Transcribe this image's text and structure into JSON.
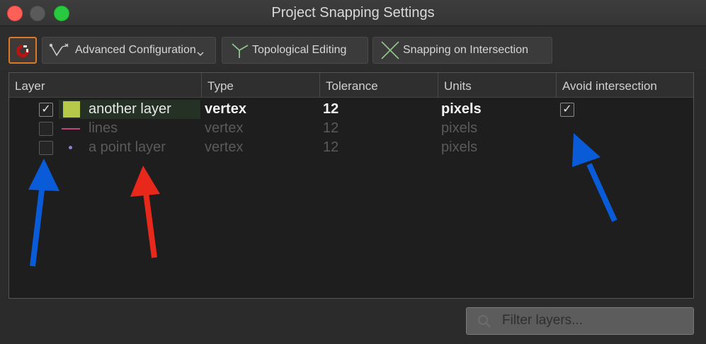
{
  "window": {
    "title": "Project Snapping Settings"
  },
  "toolbar": {
    "magnet_icon": "magnet-icon",
    "advanced_label": "Advanced Configuration",
    "topological_label": "Topological Editing",
    "intersection_label": "Snapping on Intersection"
  },
  "table": {
    "columns": [
      "Layer",
      "Type",
      "Tolerance",
      "Units",
      "Avoid intersection"
    ],
    "rows": [
      {
        "enabled": true,
        "symbol": "polygon-fill",
        "symbol_color": "#b6c949",
        "name": "another layer",
        "type": "vertex",
        "tolerance": "12",
        "units": "pixels",
        "avoid_intersection": true
      },
      {
        "enabled": false,
        "symbol": "line",
        "symbol_color": "#c0457a",
        "name": "lines",
        "type": "vertex",
        "tolerance": "12",
        "units": "pixels",
        "avoid_intersection": null
      },
      {
        "enabled": false,
        "symbol": "point",
        "symbol_color": "#8f7fd0",
        "name": "a point layer",
        "type": "vertex",
        "tolerance": "12",
        "units": "pixels",
        "avoid_intersection": null
      }
    ]
  },
  "filter": {
    "placeholder": "Filter layers..."
  },
  "annotations": {
    "colors": {
      "blue": "#0a5bd8",
      "red": "#e8281a"
    }
  },
  "colors": {
    "accent": "#d97a2b",
    "close": "#fe5f57",
    "maximize": "#28c840"
  }
}
